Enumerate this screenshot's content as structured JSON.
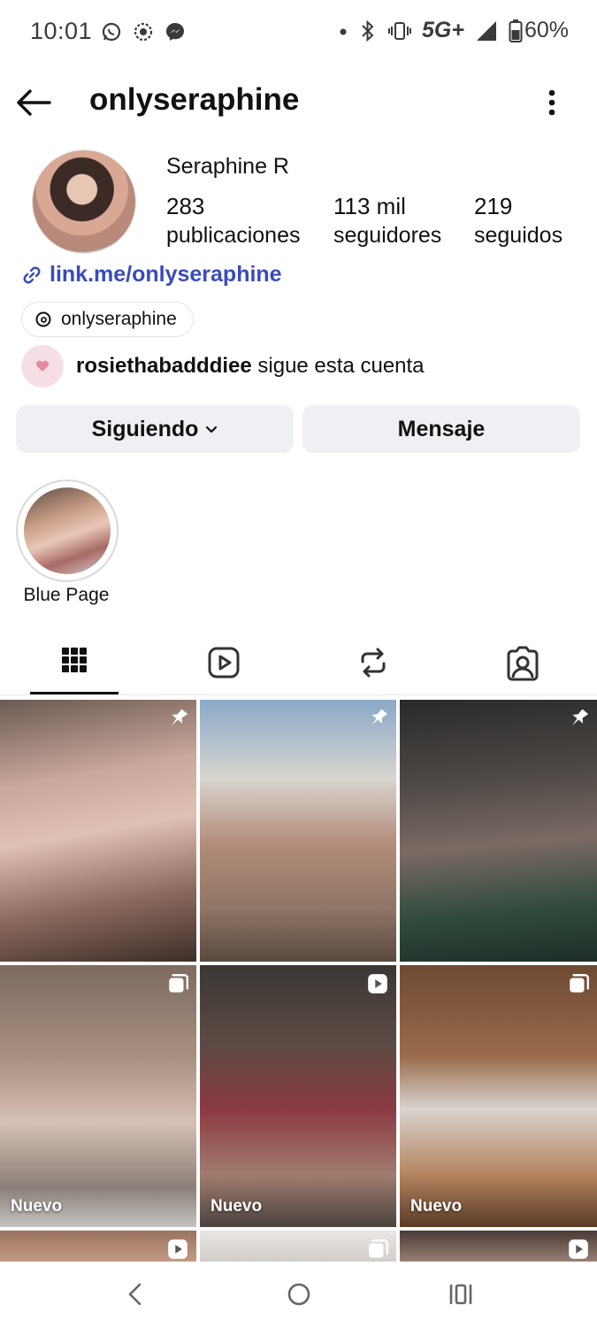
{
  "status_bar": {
    "time": "10:01",
    "network": "5G+",
    "battery": "60%",
    "icons": [
      "whatsapp-icon",
      "screen-record-icon",
      "messenger-icon",
      "dot-icon",
      "bluetooth-icon",
      "vibrate-icon",
      "signal-icon",
      "battery-icon"
    ]
  },
  "header": {
    "username": "onlyseraphine"
  },
  "profile": {
    "name": "Seraphine R",
    "stats": [
      {
        "value": "283",
        "label": "publicaciones"
      },
      {
        "value": "113 mil",
        "label": "seguidores"
      },
      {
        "value": "219",
        "label": "seguidos"
      }
    ],
    "link": "link.me/onlyseraphine",
    "threads_handle": "onlyseraphine",
    "followed_by_user": "rosiethabadddiee",
    "followed_by_suffix": "sigue esta cuenta"
  },
  "actions": {
    "following_label": "Siguiendo",
    "message_label": "Mensaje"
  },
  "highlights": [
    {
      "label": "Blue Page"
    }
  ],
  "tabs": [
    {
      "icon": "grid-icon",
      "active": true
    },
    {
      "icon": "reels-icon",
      "active": false
    },
    {
      "icon": "reposts-icon",
      "active": false
    },
    {
      "icon": "tagged-icon",
      "active": false
    }
  ],
  "grid": [
    {
      "badge": "pin-icon",
      "label": ""
    },
    {
      "badge": "pin-icon",
      "label": ""
    },
    {
      "badge": "pin-icon",
      "label": ""
    },
    {
      "badge": "carousel-icon",
      "label": "Nuevo"
    },
    {
      "badge": "reel-icon",
      "label": "Nuevo"
    },
    {
      "badge": "carousel-icon",
      "label": "Nuevo"
    },
    {
      "badge": "reel-icon",
      "label": ""
    },
    {
      "badge": "carousel-icon",
      "label": ""
    },
    {
      "badge": "reel-icon",
      "label": ""
    }
  ],
  "colors": {
    "link": "#3a4bbd",
    "button_bg": "#eef0f4",
    "text": "#111111"
  }
}
